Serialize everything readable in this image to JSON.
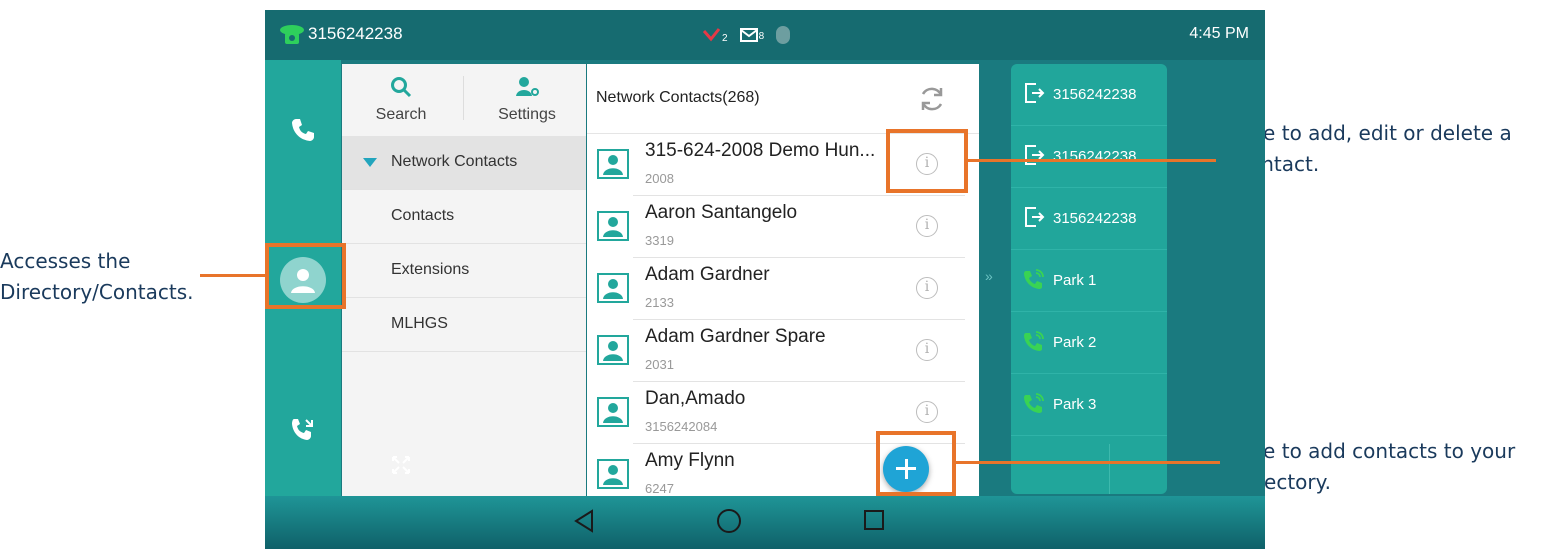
{
  "status_bar": {
    "line_number": "3156242238",
    "missed_calls_count": "2",
    "voicemail_count": "8",
    "time": "4:45 PM"
  },
  "left_rail": {
    "icons": [
      "phone-icon",
      "contacts-icon",
      "call-forward-icon"
    ]
  },
  "nav": {
    "search_label": "Search",
    "settings_label": "Settings",
    "items": [
      {
        "label": "Network Contacts",
        "active": true
      },
      {
        "label": "Contacts",
        "active": false
      },
      {
        "label": "Extensions",
        "active": false
      },
      {
        "label": "MLHGS",
        "active": false
      }
    ]
  },
  "list": {
    "title": "Network Contacts(268)",
    "contacts": [
      {
        "name": "315-624-2008 Demo Hun...",
        "number": "2008"
      },
      {
        "name": "Aaron Santangelo",
        "number": "3319"
      },
      {
        "name": "Adam Gardner",
        "number": "2133"
      },
      {
        "name": "Adam Gardner Spare",
        "number": "2031"
      },
      {
        "name": "Dan,Amado",
        "number": "3156242084"
      },
      {
        "name": "Amy Flynn",
        "number": "6247"
      }
    ],
    "info_glyph": "i"
  },
  "right_panel": {
    "items": [
      {
        "label": "3156242238",
        "icon": "line-key-icon"
      },
      {
        "label": "3156242238",
        "icon": "line-key-icon"
      },
      {
        "label": "3156242238",
        "icon": "line-key-icon"
      },
      {
        "label": "Park 1",
        "icon": "park-icon"
      },
      {
        "label": "Park 2",
        "icon": "park-icon"
      },
      {
        "label": "Park 3",
        "icon": "park-icon"
      }
    ],
    "chevron": "»"
  },
  "annotations": {
    "left": "Accesses the Directory/Contacts.",
    "right_top": "Use to add, edit or delete a contact.",
    "right_bottom": "Use to add contacts to your directory."
  },
  "colors": {
    "accent_orange": "#e8742a",
    "teal": "#22a79c",
    "fab_blue": "#1fa4d6",
    "annotation_text": "#1a3a5c"
  }
}
